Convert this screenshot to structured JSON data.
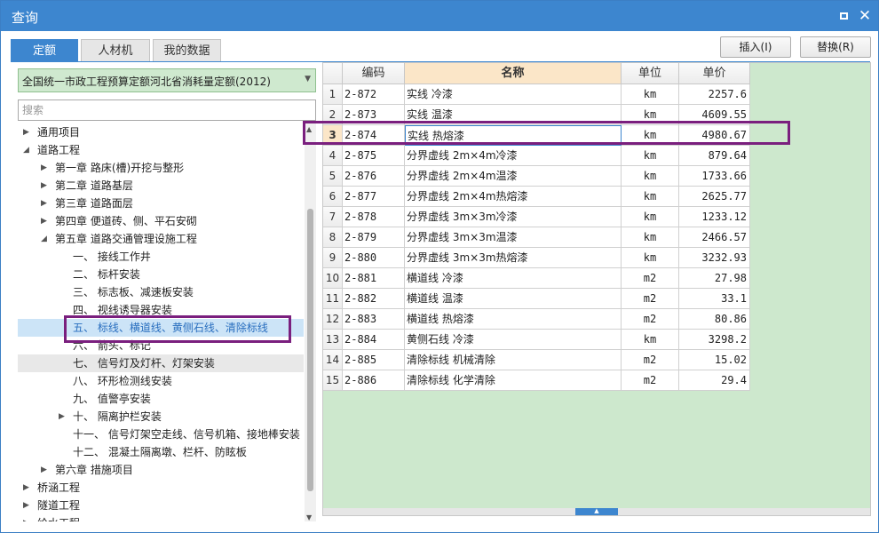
{
  "window": {
    "title": "查询"
  },
  "tabs": [
    {
      "label": "定额"
    },
    {
      "label": "人材机"
    },
    {
      "label": "我的数据"
    }
  ],
  "buttons": {
    "insert": "插入(I)",
    "replace": "替换(R)"
  },
  "quota_library": {
    "selected": "全国统一市政工程预算定额河北省消耗量定额(2012)"
  },
  "search": {
    "placeholder": "搜索"
  },
  "tree": {
    "nodes": [
      {
        "label": "通用项目"
      },
      {
        "label": "道路工程"
      },
      {
        "label": "第一章 路床(槽)开挖与整形"
      },
      {
        "label": "第二章 道路基层"
      },
      {
        "label": "第三章 道路面层"
      },
      {
        "label": "第四章 便道砖、侧、平石安砌"
      },
      {
        "label": "第五章 道路交通管理设施工程"
      },
      {
        "label": "一、 接线工作井"
      },
      {
        "label": "二、 标杆安装"
      },
      {
        "label": "三、 标志板、减速板安装"
      },
      {
        "label": "四、 视线诱导器安装"
      },
      {
        "label": "五、 标线、横道线、黄侧石线、清除标线"
      },
      {
        "label": "六、 箭头、标记"
      },
      {
        "label": "七、 信号灯及灯杆、灯架安装"
      },
      {
        "label": "八、 环形检测线安装"
      },
      {
        "label": "九、 值警亭安装"
      },
      {
        "label": "十、 隔离护栏安装"
      },
      {
        "label": "十一、 信号灯架空走线、信号机箱、接地棒安装"
      },
      {
        "label": "十二、 混凝土隔离墩、栏杆、防眩板"
      },
      {
        "label": "第六章 措施项目"
      },
      {
        "label": "桥涵工程"
      },
      {
        "label": "隧道工程"
      },
      {
        "label": "给水工程"
      }
    ]
  },
  "table": {
    "columns": {
      "code": "编码",
      "name": "名称",
      "unit": "单位",
      "price": "单价"
    },
    "rows": [
      {
        "n": "1",
        "code": "2-872",
        "name": "实线 冷漆",
        "unit": "km",
        "price": "2257.6"
      },
      {
        "n": "2",
        "code": "2-873",
        "name": "实线 温漆",
        "unit": "km",
        "price": "4609.55"
      },
      {
        "n": "3",
        "code": "2-874",
        "name": "实线 热熔漆",
        "unit": "km",
        "price": "4980.67"
      },
      {
        "n": "4",
        "code": "2-875",
        "name": "分界虚线 2m×4m冷漆",
        "unit": "km",
        "price": "879.64"
      },
      {
        "n": "5",
        "code": "2-876",
        "name": "分界虚线 2m×4m温漆",
        "unit": "km",
        "price": "1733.66"
      },
      {
        "n": "6",
        "code": "2-877",
        "name": "分界虚线 2m×4m热熔漆",
        "unit": "km",
        "price": "2625.77"
      },
      {
        "n": "7",
        "code": "2-878",
        "name": "分界虚线 3m×3m冷漆",
        "unit": "km",
        "price": "1233.12"
      },
      {
        "n": "8",
        "code": "2-879",
        "name": "分界虚线 3m×3m温漆",
        "unit": "km",
        "price": "2466.57"
      },
      {
        "n": "9",
        "code": "2-880",
        "name": "分界虚线 3m×3m热熔漆",
        "unit": "km",
        "price": "3232.93"
      },
      {
        "n": "10",
        "code": "2-881",
        "name": "横道线 冷漆",
        "unit": "m2",
        "price": "27.98"
      },
      {
        "n": "11",
        "code": "2-882",
        "name": "横道线 温漆",
        "unit": "m2",
        "price": "33.1"
      },
      {
        "n": "12",
        "code": "2-883",
        "name": "横道线 热熔漆",
        "unit": "m2",
        "price": "80.86"
      },
      {
        "n": "13",
        "code": "2-884",
        "name": "黄侧石线 冷漆",
        "unit": "km",
        "price": "3298.2"
      },
      {
        "n": "14",
        "code": "2-885",
        "name": "清除标线 机械清除",
        "unit": "m2",
        "price": "15.02"
      },
      {
        "n": "15",
        "code": "2-886",
        "name": "清除标线 化学清除",
        "unit": "m2",
        "price": "29.4"
      }
    ]
  },
  "colors": {
    "accent": "#3d86cf",
    "highlight": "#7a1f7e",
    "grid_bg": "#cde8cd",
    "header_active": "#fbe6c8"
  }
}
